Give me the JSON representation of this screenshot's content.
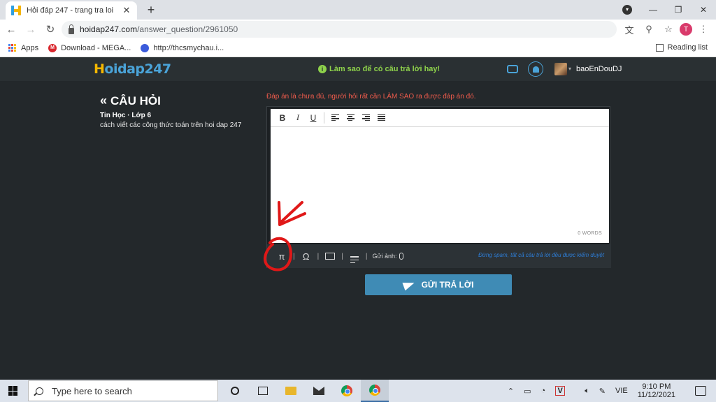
{
  "browser": {
    "tab_title": "Hỏi đáp 247 - trang tra loi",
    "url_domain": "hoidap247.com",
    "url_path": "/answer_question/2961050",
    "bookmarks": [
      {
        "label": "Apps"
      },
      {
        "label": "Download - MEGA..."
      },
      {
        "label": "http://thcsmychau.i..."
      }
    ],
    "reading_list": "Reading list",
    "profile_initial": "T"
  },
  "site": {
    "logo_h": "H",
    "logo_rest": "oidap247",
    "tip": "Làm sao để có câu trả lời hay!",
    "username": "baoEnDouDJ"
  },
  "question": {
    "heading": "CÂU HỎI",
    "meta": "Tin Học · Lớp 6",
    "text": "cách viết các công thức toán trên hoi dap 247"
  },
  "editor": {
    "warning": "Đáp án là chưa đủ, người hỏi rất cần LÀM SAO ra được đáp án đó.",
    "bold": "B",
    "italic": "I",
    "underline": "U",
    "word_count": "0 WORDS",
    "math_symbol": "π",
    "omega_symbol": "Ω",
    "image_label": "Gửi ảnh:",
    "note": "Đừng spam, tất cả câu trả lời đều được kiểm duyệt",
    "submit": "GỬI TRẢ LỜI"
  },
  "taskbar": {
    "search_placeholder": "Type here to search",
    "lang": "VIE",
    "time": "9:10 PM",
    "date": "11/12/2021"
  }
}
